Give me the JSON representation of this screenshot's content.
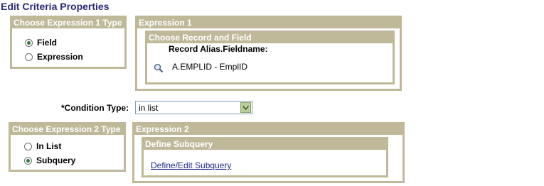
{
  "page": {
    "title": "Edit Criteria Properties"
  },
  "expr1_type": {
    "header": "Choose Expression 1 Type",
    "options": [
      {
        "label": "Field",
        "checked": true
      },
      {
        "label": "Expression",
        "checked": false
      }
    ]
  },
  "expression1": {
    "header": "Expression 1",
    "record_field": {
      "header": "Choose Record and Field",
      "column_label": "Record Alias.Fieldname:",
      "value": "A.EMPLID - EmplID",
      "lookup_icon": "magnifier-icon"
    }
  },
  "condition": {
    "label": "*Condition Type:",
    "selected": "in list"
  },
  "expr2_type": {
    "header": "Choose Expression 2 Type",
    "options": [
      {
        "label": "In List",
        "checked": false
      },
      {
        "label": "Subquery",
        "checked": true
      }
    ]
  },
  "expression2": {
    "header": "Expression 2",
    "subquery": {
      "header": "Define Subquery",
      "link": "Define/Edit Subquery"
    }
  },
  "colors": {
    "group_header": "#bfb99a",
    "title": "#2a2a7a",
    "link": "#1f2a8f"
  }
}
